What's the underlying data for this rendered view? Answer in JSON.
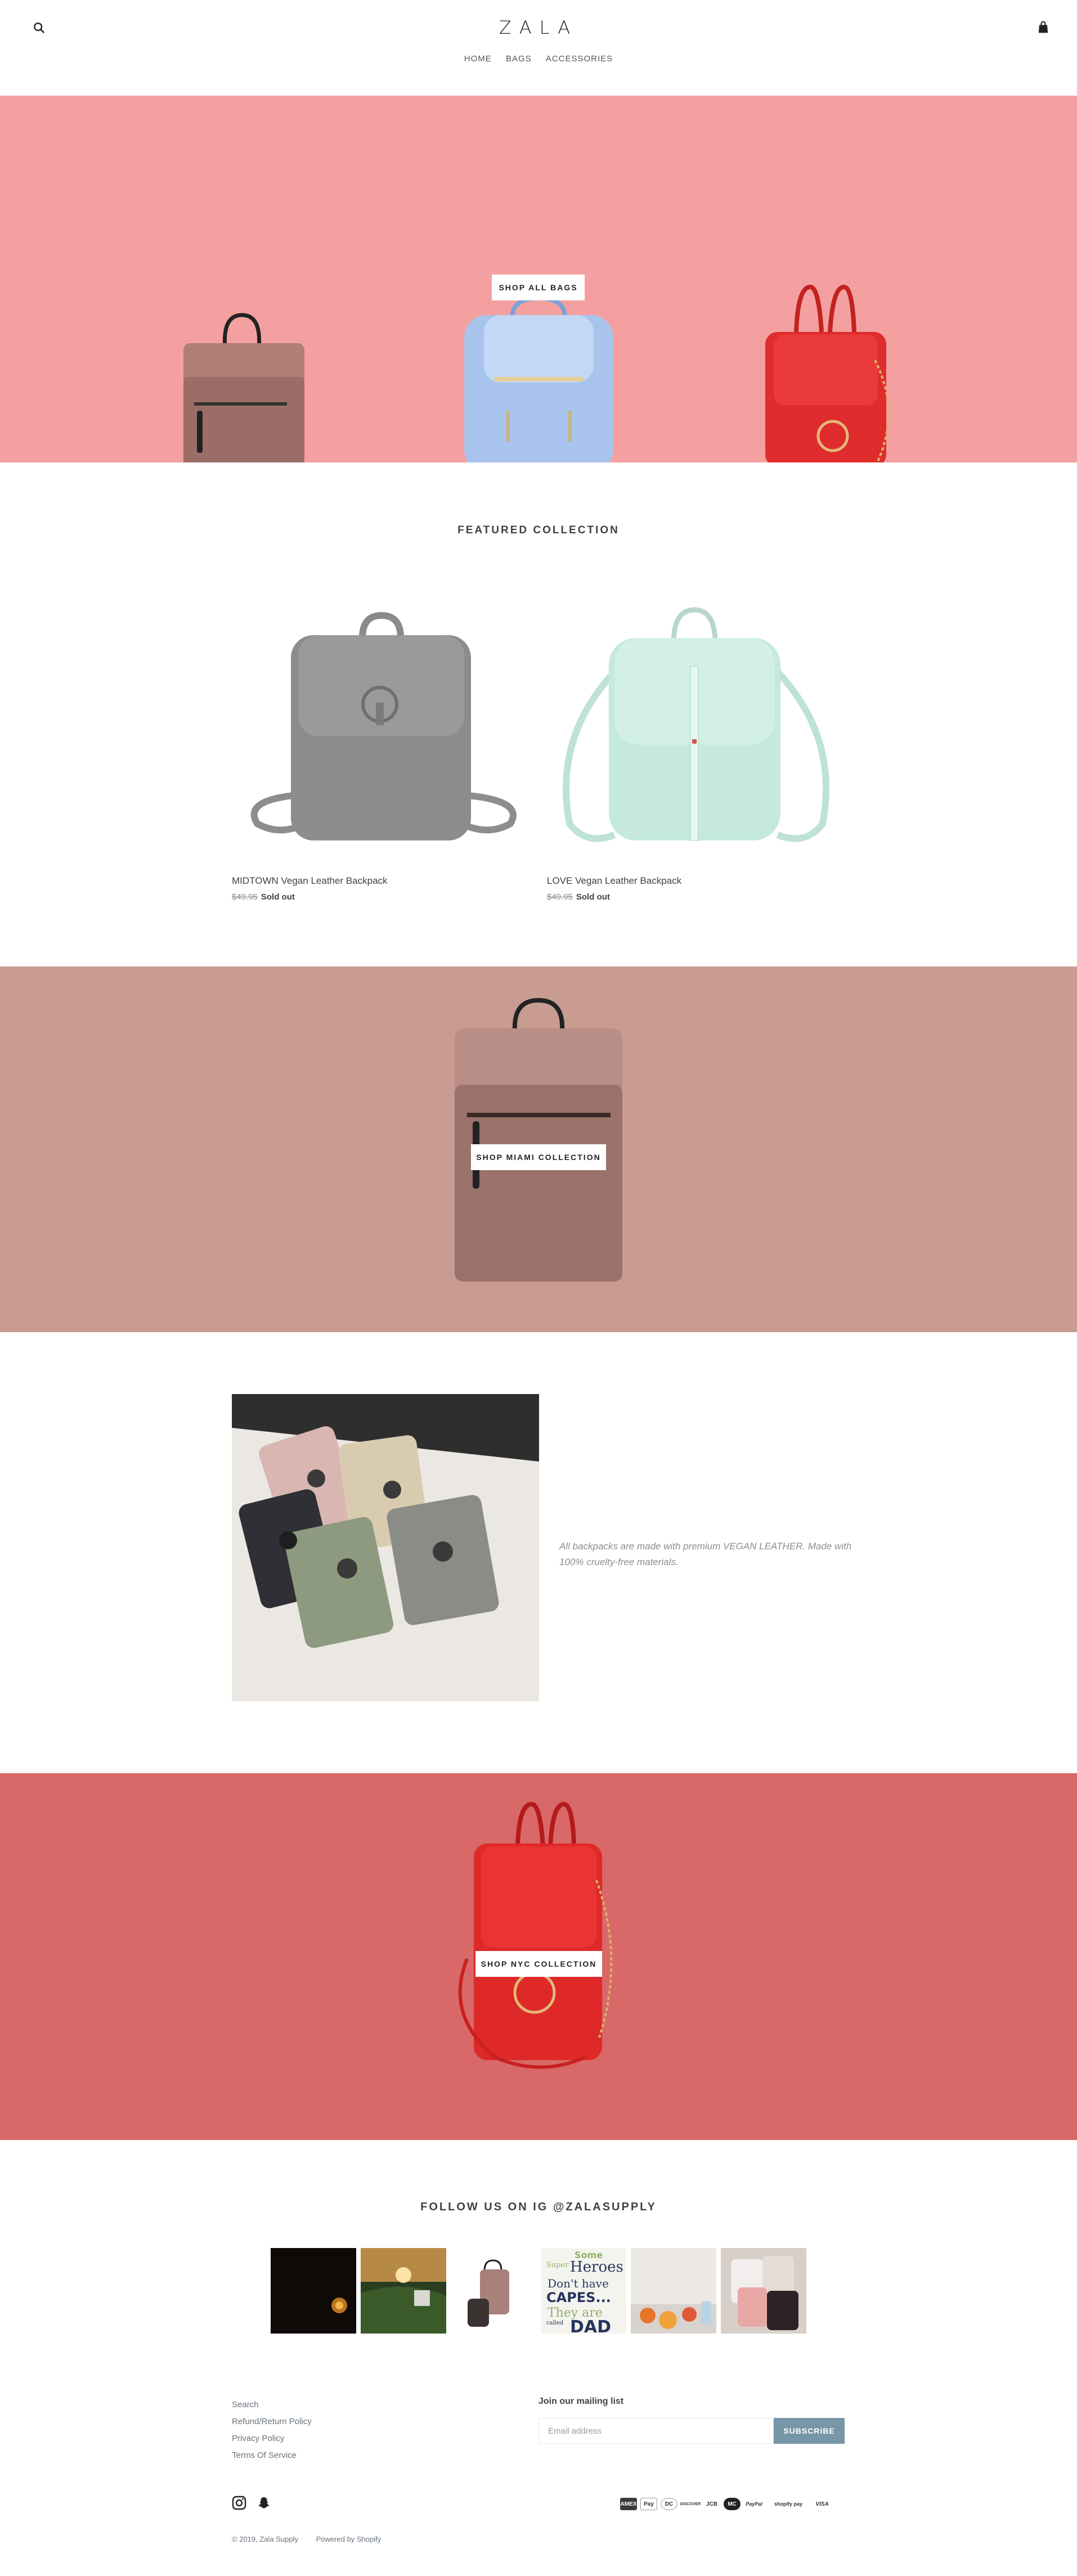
{
  "header": {
    "logo": "ZALA",
    "nav": [
      "HOME",
      "BAGS",
      "ACCESSORIES"
    ]
  },
  "hero": {
    "button_label": "SHOP ALL BAGS",
    "bg_color": "#f4a0a0"
  },
  "featured": {
    "title": "FEATURED COLLECTION",
    "products": [
      {
        "name": "MIDTOWN Vegan Leather Backpack",
        "price": "$49.95",
        "status": "Sold out"
      },
      {
        "name": "LOVE Vegan Leather Backpack",
        "price": "$49.95",
        "status": "Sold out"
      }
    ]
  },
  "miami": {
    "button_label": "SHOP MIAMI COLLECTION",
    "bg_color": "#c99c91"
  },
  "about": {
    "text": "All backpacks are made with premium VEGAN LEATHER. Made with 100% cruelty-free materials."
  },
  "nyc": {
    "button_label": "SHOP NYC COLLECTION",
    "bg_color": "#d96868"
  },
  "instagram": {
    "title": "FOLLOW US ON IG @ZALASUPPLY",
    "tile_text": [
      "Some",
      "Super",
      "Heroes",
      "Don't have",
      "CAPES...",
      "They are",
      "called",
      "DAD"
    ]
  },
  "footer": {
    "links": [
      "Search",
      "Refund/Return Policy",
      "Privacy Policy",
      "Terms Of Service"
    ],
    "mailing_title": "Join our mailing list",
    "email_placeholder": "Email address",
    "subscribe_label": "SUBSCRIBE",
    "payments": [
      "AMEX",
      "Pay",
      "DC",
      "DISCOVER",
      "JCB",
      "MC",
      "PayPal",
      "shopify pay",
      "VISA"
    ],
    "copyright": "© 2019, Zala Supply",
    "powered": "Powered by Shopify"
  },
  "colors": {
    "accent": "#7796a8",
    "text": "#3d4246"
  }
}
